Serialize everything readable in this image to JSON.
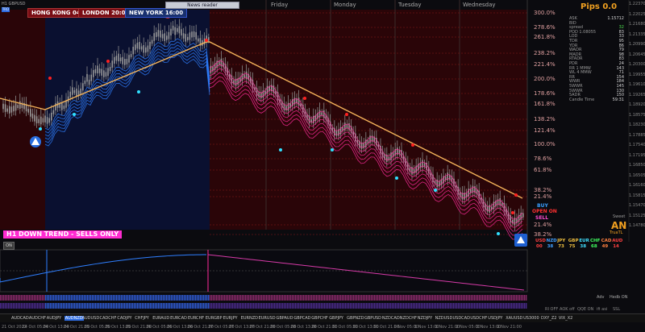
{
  "window": {
    "symbol": "H1 GBPUSD"
  },
  "sessions": {
    "hongkong": "HONG KONG 04:00",
    "london": "LONDON 20:00",
    "newyork": "NEW YORK 16:00"
  },
  "news_reader": "News reader",
  "days": [
    "Friday",
    "Monday",
    "Tuesday",
    "Wednesday"
  ],
  "fib_levels": [
    "300.0%",
    "278.6%",
    "261.8%",
    "238.2%",
    "221.4%",
    "200.0%",
    "178.6%",
    "161.8%",
    "138.2%",
    "121.4%",
    "100.0%",
    "78.6%",
    "61.8%",
    "38.2%",
    "21.4%",
    "21.4%",
    "38.2%"
  ],
  "price_labels": [
    "1.22370",
    "1.22025",
    "1.21680",
    "1.21335",
    "1.20990",
    "1.20645",
    "1.20300",
    "1.19955",
    "1.19610",
    "1.19265",
    "1.18920",
    "1.18575",
    "1.18230",
    "1.17885",
    "1.17540",
    "1.17195",
    "1.16850",
    "1.16505",
    "1.16160",
    "1.15815",
    "1.15470",
    "1.15125",
    "1.14780"
  ],
  "trend_banner": "H1  DOWN TREND - SELLS ONLY",
  "on_button": "ON",
  "panel": {
    "title": "Pips 0.0",
    "rows": [
      {
        "k": "ASK",
        "v": "1.15712"
      },
      {
        "k": "BID",
        "v": ""
      },
      {
        "k": "spread",
        "v": "32"
      },
      {
        "k": "POD 1.08055",
        "v": "83"
      },
      {
        "k": "LOD",
        "v": "33"
      },
      {
        "k": "TDR",
        "v": "95"
      },
      {
        "k": "YDR",
        "v": "86"
      },
      {
        "k": "WADR",
        "v": "79"
      },
      {
        "k": "MADR",
        "v": "98"
      },
      {
        "k": "RTADR",
        "v": "83"
      },
      {
        "k": "PDR",
        "v": "24"
      },
      {
        "k": "RR 1 MMW",
        "v": "143"
      },
      {
        "k": "WL 4 MMW",
        "v": "71"
      },
      {
        "k": "RR",
        "v": "154"
      },
      {
        "k": "WWR",
        "v": "184"
      },
      {
        "k": "5WWR",
        "v": "145"
      },
      {
        "k": "5WWR",
        "v": "130"
      },
      {
        "k": "5ADR",
        "v": "150"
      },
      {
        "k": "Candle Time",
        "v": "59:31"
      }
    ]
  },
  "signals": {
    "buy": "BUY",
    "open_on": "OPEN ON",
    "sell": "SELL",
    "an": "AN",
    "trutb": "TruaTL",
    "sweet": "Sweet"
  },
  "currencies": [
    "USD",
    "NZD",
    "JPY",
    "GBP",
    "EUR",
    "CHF",
    "CAD",
    "AUD"
  ],
  "strengths": [
    "00",
    "38",
    "73",
    "75",
    "38",
    "68",
    "49",
    "14"
  ],
  "bottom_right_labels": {
    "r1": "Adv",
    "r2": "Hedb ON",
    "r3a": "RI OFF",
    "r3b": "AOK off",
    "r3c": "QQE ON",
    "r3d": "ifi asi",
    "r3e": "SSL"
  },
  "pairs": [
    "AUDCAD",
    "AUDCHF",
    "AUDJPY",
    "AUDNZD",
    "AUDUSD",
    "CADCHF",
    "CADJPY",
    "CHFJPY",
    "EURAUD",
    "EURCAD",
    "EURCHF",
    "EURGBP",
    "EURJPY",
    "EURNZD",
    "EURUSD",
    "GBPAUD",
    "GBPCAD",
    "GBPCHF",
    "GBPJPY",
    "GBPNZD",
    "GBPUSD",
    "NZDCAD",
    "NZDCHF",
    "NZDJPY",
    "NZDUSD",
    "USDCAD",
    "USDCHF",
    "USDJPY",
    "XAUUSD",
    "US3000",
    "DXY_Z2",
    "VIX_X2"
  ],
  "active_pair": "AUDNZD",
  "time_ticks": [
    "21 Oct 2022",
    "24 Oct 05:00",
    "24 Oct 13:00",
    "24 Oct 21:00",
    "25 Oct 05:00",
    "25 Oct 13:00",
    "25 Oct 21:00",
    "26 Oct 05:00",
    "26 Oct 13:00",
    "26 Oct 21:00",
    "27 Oct 05:00",
    "27 Oct 13:00",
    "27 Oct 21:00",
    "28 Oct 05:00",
    "28 Oct 13:00",
    "28 Oct 21:00",
    "31 Oct 05:00",
    "31 Oct 13:00",
    "31 Oct 21:00",
    "1 Nov 05:00",
    "1 Nov 13:00",
    "1 Nov 21:00",
    "2 Nov 05:00",
    "2 Nov 13:00",
    "2 Nov 21:00"
  ],
  "colors": {
    "bg_red": "#2a0508",
    "bg_blue": "#0a1030",
    "candle": "#7a7a7a",
    "ema": "#f3b35a",
    "ribbon_up": "#2f7fff",
    "ribbon_dn": "#ff2a9a",
    "dot_cyan": "#30e0ff",
    "dot_red": "#ff2020"
  }
}
